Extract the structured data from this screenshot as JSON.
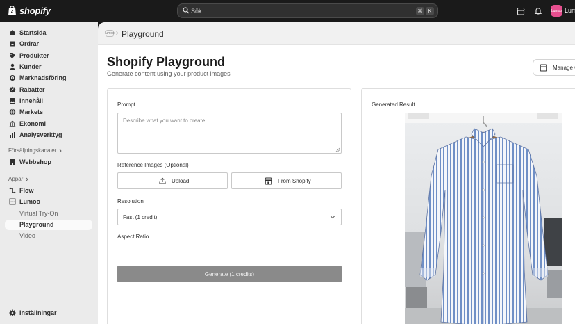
{
  "topbar": {
    "logo_text": "shopify",
    "search_placeholder": "Sök",
    "shortcut_key1": "⌘",
    "shortcut_key2": "K",
    "store_avatar_text": "Lumoo",
    "store_name": "Lumo"
  },
  "sidebar": {
    "items": [
      {
        "label": "Startsida",
        "icon": "home-icon"
      },
      {
        "label": "Ordrar",
        "icon": "inbox-icon"
      },
      {
        "label": "Produkter",
        "icon": "tag-icon"
      },
      {
        "label": "Kunder",
        "icon": "person-icon"
      },
      {
        "label": "Marknadsföring",
        "icon": "target-icon"
      },
      {
        "label": "Rabatter",
        "icon": "discount-icon"
      },
      {
        "label": "Innehåll",
        "icon": "content-icon"
      },
      {
        "label": "Markets",
        "icon": "globe-icon"
      },
      {
        "label": "Ekonomi",
        "icon": "bank-icon"
      },
      {
        "label": "Analysverktyg",
        "icon": "chart-icon"
      }
    ],
    "sales_channels_label": "Försäljningskanaler",
    "webshop_label": "Webbshop",
    "apps_label": "Appar",
    "flow_label": "Flow",
    "lumoo_label": "Lumoo",
    "lumoo_badge": "Lumoo",
    "sub_items": [
      "Virtual Try-On",
      "Playground",
      "Video"
    ],
    "settings_label": "Inställningar"
  },
  "header": {
    "breadcrumb_badge": "lumoo",
    "title": "Playground"
  },
  "page": {
    "title": "Shopify Playground",
    "subtitle": "Generate content using your product images",
    "manage_label": "Manage Credits"
  },
  "form": {
    "prompt_label": "Prompt",
    "prompt_placeholder": "Describe what you want to create...",
    "reference_label": "Reference Images (Optional)",
    "upload_label": "Upload",
    "from_shopify_label": "From Shopify",
    "resolution_label": "Resolution",
    "resolution_value": "Fast (1 credit)",
    "aspect_label": "Aspect Ratio",
    "generate_label": "Generate (1 credits)"
  },
  "result": {
    "title": "Generated Result"
  },
  "colors": {
    "topbar": "#1a1a1a",
    "sidebar": "#ebebeb",
    "generate_button": "#8a8a8a",
    "shirt_stripe": "#6f8fc6",
    "avatar": "#e74f8f"
  }
}
